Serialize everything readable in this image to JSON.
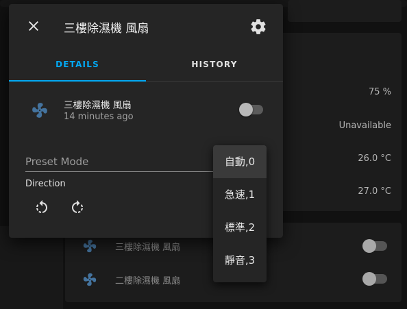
{
  "background": {
    "values": [
      {
        "text": "75 %"
      },
      {
        "text": "Unavailable"
      },
      {
        "text": "26.0 °C"
      },
      {
        "text": "27.0 °C"
      }
    ],
    "fan_rows": [
      {
        "name": "三樓除濕機 風扇"
      },
      {
        "name": "二樓除濕機 風扇"
      }
    ]
  },
  "dialog": {
    "title": "三樓除濕機 風扇",
    "tabs": [
      {
        "label": "DETAILS",
        "active": true
      },
      {
        "label": "HISTORY",
        "active": false
      }
    ],
    "entity": {
      "name": "三樓除濕機 風扇",
      "last_changed": "14 minutes ago",
      "state": "off"
    },
    "preset_mode": {
      "label": "Preset Mode",
      "options": [
        "自動,0",
        "急速,1",
        "標準,2",
        "靜音,3"
      ],
      "highlighted": "自動,0"
    },
    "direction": {
      "label": "Direction"
    }
  },
  "colors": {
    "accent": "#03a9f4",
    "fan_icon": "#44739e",
    "dialog_bg": "#252525",
    "page_bg": "#111111"
  },
  "icons": [
    "close-icon",
    "cog-icon",
    "fan-icon",
    "rotate-left-icon",
    "rotate-right-icon"
  ]
}
